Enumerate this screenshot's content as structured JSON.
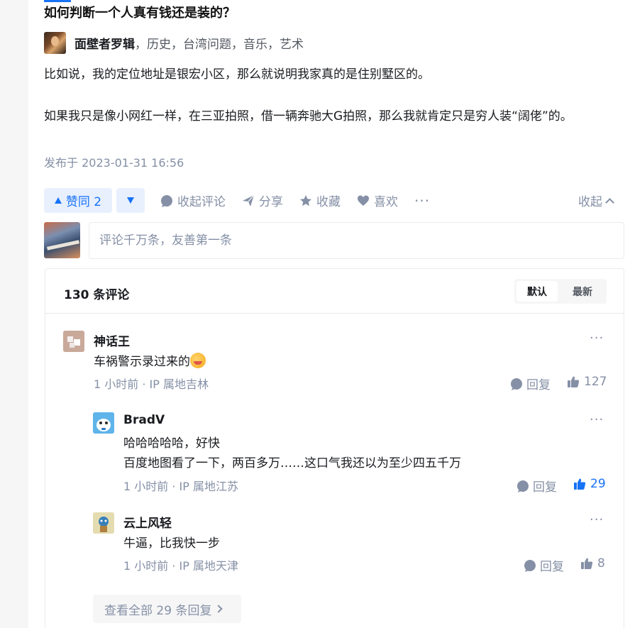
{
  "question": {
    "title": "如何判断一个人真有钱还是装的？"
  },
  "author": {
    "name": "面壁者罗辑",
    "tags": "，历史，台湾问题，音乐，艺术"
  },
  "answer": {
    "paragraphs": [
      "比如说，我的定位地址是银宏小区，那么就说明我家真的是住别墅区的。",
      "如果我只是像小网红一样，在三亚拍照，借一辆奔驰大G拍照，那么我就肯定只是穷人装“阔佬”的。"
    ],
    "publish_time": "发布于 2023-01-31 16:56"
  },
  "actions": {
    "vote_up": "赞同 2",
    "collapse_comments": "收起评论",
    "share": "分享",
    "favorite": "收藏",
    "like": "喜欢",
    "more": "···",
    "collapse": "收起"
  },
  "comment_box": {
    "placeholder": "评论千万条，友善第一条"
  },
  "comments_panel": {
    "count_label": "130 条评论",
    "sort_default": "默认",
    "sort_latest": "最新",
    "comments": [
      {
        "name": "神话王",
        "text": "车祸警示录过来的",
        "meta": "1 小时前 · IP 属地吉林",
        "reply_label": "回复",
        "likes": "127",
        "liked": false
      },
      {
        "name": "BradV",
        "text_lines": [
          "哈哈哈哈哈，好快",
          "百度地图看了一下，两百多万……这口气我还以为至少四五千万"
        ],
        "meta": "1 小时前 · IP 属地江苏",
        "reply_label": "回复",
        "likes": "29",
        "liked": true
      },
      {
        "name": "云上风轻",
        "text": "牛逼，比我快一步",
        "meta": "1 小时前 · IP 属地天津",
        "reply_label": "回复",
        "likes": "8",
        "liked": false
      }
    ],
    "view_all": "查看全部 29 条回复"
  },
  "colors": {
    "accent": "#1772f6",
    "muted": "#8590a6"
  }
}
